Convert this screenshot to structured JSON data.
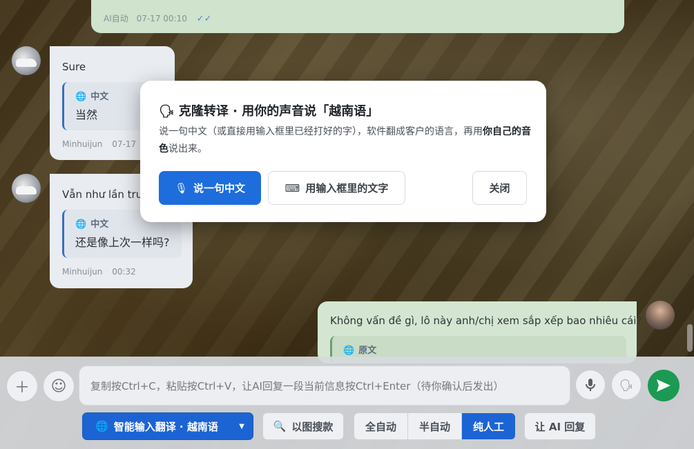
{
  "messages": {
    "top_out": {
      "meta_sender": "AI自动",
      "meta_time": "07-17 00:10",
      "status_icon": "double-check-icon"
    },
    "in1": {
      "text": "Sure",
      "quote_label": "中文",
      "quote_text": "当然",
      "sender": "Minhuijun",
      "time": "07-17"
    },
    "in2": {
      "text": "Vẫn như lần trước",
      "quote_label": "中文",
      "quote_text": "还是像上次一样吗?",
      "sender": "Minhuijun",
      "time": "00:32"
    },
    "out1": {
      "text": "Không vấn đề gì, lô này anh/chị xem sắp xếp bao nhiêu cái?",
      "quote_label": "原文"
    }
  },
  "modal": {
    "title": "克隆转译 · 用你的声音说「越南语」",
    "title_icon": "speaking-head-icon",
    "desc_part1": "说一句中文（或直接用输入框里已经打好的字），软件翻成客户的语言，再用",
    "desc_bold": "你自己的音色",
    "desc_part2": "说出来。",
    "btn_speak": "说一句中文",
    "btn_use_input": "用输入框里的文字",
    "btn_close": "关闭"
  },
  "composer": {
    "placeholder": "复制按Ctrl+C，粘贴按Ctrl+V，让AI回复一段当前信息按Ctrl+Enter（待你确认后发出）",
    "value": ""
  },
  "toolbar": {
    "translate_label": "智能输入翻译 · 越南语",
    "image_search_label": "以图搜款",
    "mode_full_auto": "全自动",
    "mode_semi_auto": "半自动",
    "mode_manual": "纯人工",
    "ai_reply_label": "让 AI 回复"
  },
  "colors": {
    "accent": "#1c64d4",
    "send": "#1a9a52",
    "out_bubble": "#d4e6d2",
    "in_bubble": "#e9ecf1"
  }
}
